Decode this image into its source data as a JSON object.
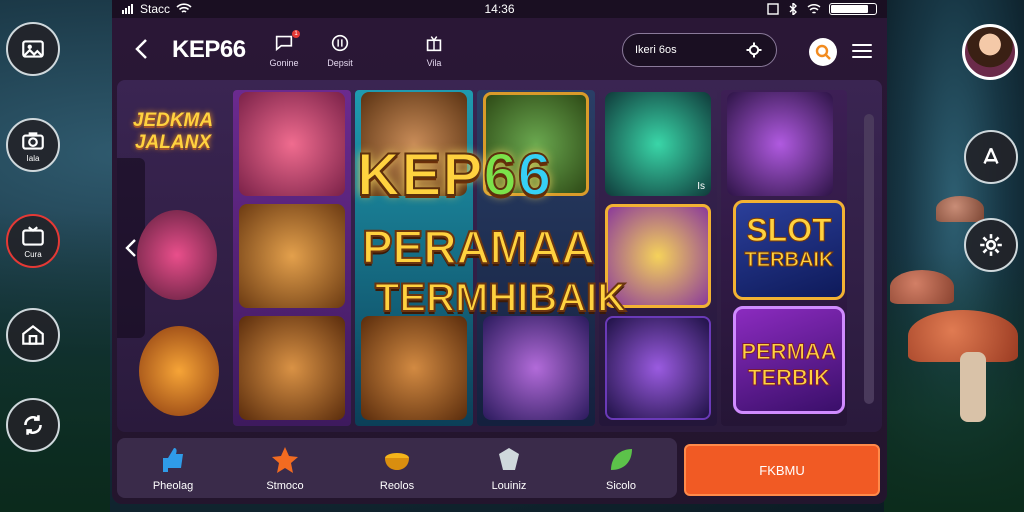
{
  "status_bar": {
    "carrier": "Stacc",
    "time": "14:36",
    "battery_level": 0.85
  },
  "header": {
    "logo": "KEP66",
    "tabs": [
      {
        "label": "Gonine",
        "icon": "chat-icon",
        "badge": "1"
      },
      {
        "label": "Depsit",
        "icon": "coin-icon"
      },
      {
        "label": "Vila",
        "icon": "gift-icon"
      }
    ],
    "search": {
      "placeholder": "Ikeri 6os"
    }
  },
  "board": {
    "left_badge": "JEDKMA JALANX",
    "title": {
      "part1": "KEP",
      "part2": "6",
      "part3": "6"
    },
    "subtitle1": "PERAMAA",
    "subtitle2": "TERMHIBAIK",
    "side_label": "Is",
    "slot_badge": {
      "line1": "SLOT",
      "line2": "TERBAIK"
    },
    "premium_badge": {
      "line1": "PERMAA",
      "line2": "TERBIK"
    }
  },
  "bottom_nav": [
    {
      "label": "Pheolag",
      "icon": "thumbs-up-icon",
      "color": "#2f9be8"
    },
    {
      "label": "Stmoco",
      "icon": "star-icon",
      "color": "#f26b21"
    },
    {
      "label": "Reolos",
      "icon": "bowl-icon",
      "color": "#f4b41a"
    },
    {
      "label": "Louiniz",
      "icon": "shield-icon",
      "color": "#cfd8dc"
    },
    {
      "label": "Sicolo",
      "icon": "leaf-icon",
      "color": "#5cc24a"
    }
  ],
  "cta": {
    "label": "FKBMU"
  },
  "side_buttons": [
    {
      "label": "",
      "icon": "image-icon"
    },
    {
      "label": "Iala",
      "icon": "camera-icon"
    },
    {
      "label": "Cura",
      "icon": "tv-icon"
    },
    {
      "label": "",
      "icon": "store-icon"
    },
    {
      "label": "",
      "icon": "sync-icon"
    }
  ],
  "right_buttons": [
    {
      "icon": "avatar"
    },
    {
      "icon": "share-icon"
    },
    {
      "icon": "settings-icon"
    }
  ]
}
